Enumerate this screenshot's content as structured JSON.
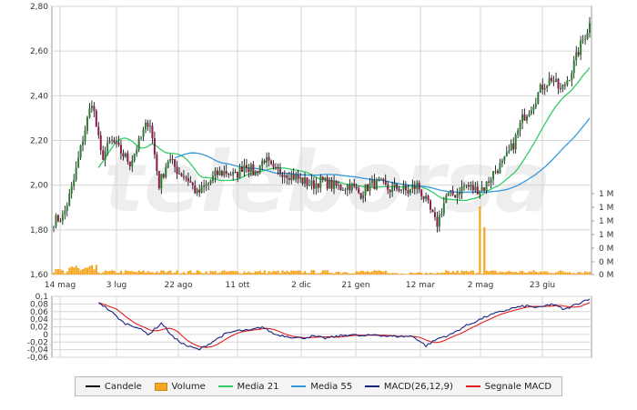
{
  "chart_data": [
    {
      "type": "candlestick",
      "yticks": [
        "2,80",
        "2,60",
        "2,40",
        "2,20",
        "2,00",
        "1,80",
        "1,60"
      ],
      "ylim": [
        1.6,
        2.8
      ],
      "xticks": [
        "14 mag",
        "3 lug",
        "22 ago",
        "11 ott",
        "2 dic",
        "21 gen",
        "12 mar",
        "2 mag",
        "23 giu"
      ],
      "volume_ticks": [
        "1 M",
        "1 M",
        "1 M",
        "1 M",
        "0 M",
        "0 M",
        "0 M"
      ],
      "grid": true,
      "close_anchors": [
        1.84,
        1.86,
        2.0,
        2.2,
        2.38,
        2.12,
        2.2,
        2.15,
        2.1,
        2.2,
        2.3,
        2.0,
        2.12,
        2.06,
        2.03,
        1.96,
        2.0,
        2.05,
        2.06,
        2.04,
        2.1,
        2.05,
        2.12,
        2.06,
        2.06,
        2.04,
        2.02,
        2.0,
        2.02,
        2.0,
        1.99,
        2.0,
        1.96,
        2.0,
        2.01,
        1.98,
        1.99,
        1.97,
        2.0,
        1.92,
        1.82,
        1.95,
        1.96,
        2.0,
        1.98,
        1.99,
        2.06,
        2.1,
        2.18,
        2.3,
        2.36,
        2.44,
        2.48,
        2.42,
        2.5,
        2.62,
        2.72
      ],
      "series": [
        {
          "name": "Candele",
          "type": "candlestick"
        },
        {
          "name": "Volume",
          "type": "bar"
        },
        {
          "name": "Media 21",
          "type": "line"
        },
        {
          "name": "Media 55",
          "type": "line"
        }
      ]
    },
    {
      "type": "line",
      "yticks": [
        "0,1",
        "0,08",
        "0,06",
        "0,04",
        "0,02",
        "0",
        "-0,02",
        "-0,04",
        "-0,06"
      ],
      "ylim": [
        -0.06,
        0.1
      ],
      "macd_anchors": [
        0.085,
        0.06,
        0.03,
        0.02,
        0.0,
        0.03,
        -0.01,
        -0.03,
        -0.04,
        -0.02,
        0.0,
        0.01,
        0.01,
        0.02,
        0.0,
        -0.005,
        -0.01,
        -0.005,
        -0.01,
        -0.005,
        0.0,
        -0.005,
        0.0,
        -0.005,
        -0.005,
        -0.005,
        -0.03,
        -0.01,
        0.0,
        0.02,
        0.035,
        0.05,
        0.06,
        0.07,
        0.075,
        0.07,
        0.08,
        0.065,
        0.08,
        0.095
      ],
      "series": [
        {
          "name": "MACD(26,12,9)",
          "type": "line"
        },
        {
          "name": "Segnale MACD",
          "type": "line"
        }
      ]
    }
  ],
  "legend": {
    "items": [
      {
        "label": "Candele",
        "color": "#000000",
        "kind": "line"
      },
      {
        "label": "Volume",
        "color": "#f5a623",
        "kind": "bar"
      },
      {
        "label": "Media 21",
        "color": "#33cc66",
        "kind": "line"
      },
      {
        "label": "Media 55",
        "color": "#3399dd",
        "kind": "line"
      },
      {
        "label": "MACD(26,12,9)",
        "color": "#1a237e",
        "kind": "line"
      },
      {
        "label": "Segnale MACD",
        "color": "#e02020",
        "kind": "line"
      }
    ]
  },
  "colors": {
    "up": "#2e7d32",
    "down": "#8b1a4a",
    "volume": "#f5a623",
    "media21": "#33cc66",
    "media55": "#3399dd",
    "macd": "#1a237e",
    "signal": "#e02020",
    "grid": "#d6d6d6"
  }
}
